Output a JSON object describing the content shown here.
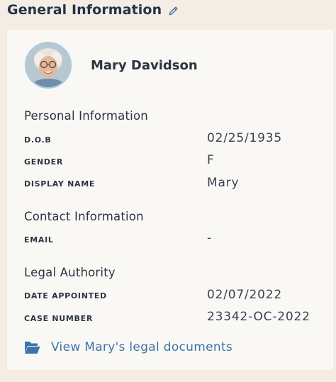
{
  "header": {
    "title": "General Information",
    "edit_icon": "pencil-icon"
  },
  "profile": {
    "name": "Mary Davidson",
    "avatar_icon": "avatar-photo"
  },
  "personal": {
    "heading": "Personal Information",
    "fields": [
      {
        "label": "D.O.B",
        "value": "02/25/1935"
      },
      {
        "label": "GENDER",
        "value": "F"
      },
      {
        "label": "DISPLAY NAME",
        "value": "Mary"
      }
    ]
  },
  "contact": {
    "heading": "Contact Information",
    "fields": [
      {
        "label": "EMAIL",
        "value": "-"
      }
    ]
  },
  "legal": {
    "heading": "Legal Authority",
    "fields": [
      {
        "label": "DATE APPOINTED",
        "value": "02/07/2022"
      },
      {
        "label": "CASE NUMBER",
        "value": "23342-OC-2022"
      }
    ]
  },
  "documents_link": {
    "label": "View Mary's legal documents",
    "icon": "folder-open-icon"
  },
  "colors": {
    "page_bg": "#f3ede3",
    "card_bg": "#faf8f5",
    "heading_text": "#25324a",
    "link_blue": "#3e73a8",
    "avatar_ring": "#a9cbe0"
  }
}
